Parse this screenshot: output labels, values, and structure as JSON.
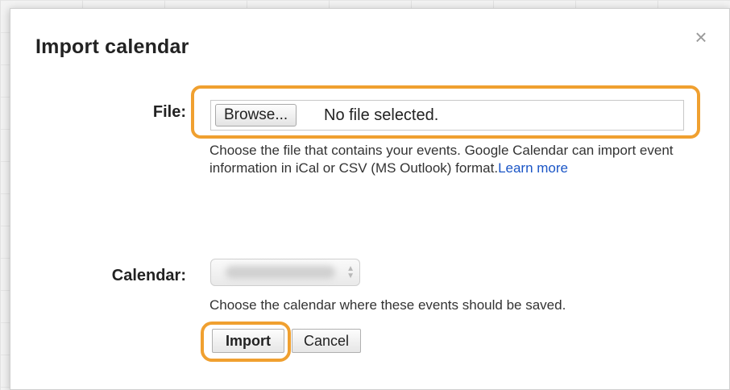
{
  "dialog": {
    "title": "Import calendar",
    "close_icon": "close-icon",
    "close_glyph": "×"
  },
  "file_field": {
    "label": "File:",
    "browse_label": "Browse...",
    "status": "No file selected.",
    "help_text": "Choose the file that contains your events. Google Calendar can import event information in iCal or CSV (MS Outlook) format.",
    "learn_more": "Learn more"
  },
  "calendar_field": {
    "label": "Calendar:",
    "help_text": "Choose the calendar where these events should be saved."
  },
  "actions": {
    "import_label": "Import",
    "cancel_label": "Cancel"
  },
  "colors": {
    "highlight": "#f0a030",
    "link": "#1a55c6"
  }
}
